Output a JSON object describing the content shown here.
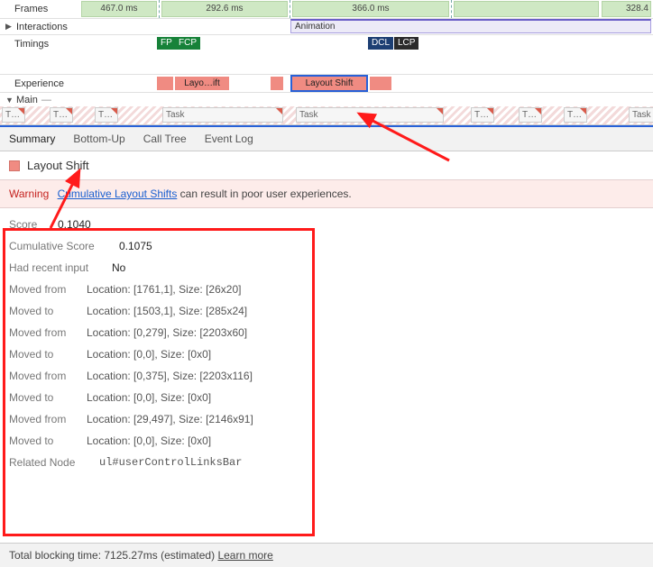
{
  "timeline": {
    "rows": {
      "frames": "Frames",
      "interactions": "Interactions",
      "timings": "Timings",
      "experience": "Experience",
      "main": "Main"
    },
    "frames": [
      "467.0 ms",
      "292.6 ms",
      "366.0 ms",
      "328.4"
    ],
    "animation_label": "Animation",
    "timing_badges": {
      "fp": "FP",
      "fcp": "FCP",
      "dcl": "DCL",
      "lcp": "LCP"
    },
    "experience": {
      "first": "Layo…ift",
      "selected": "Layout Shift"
    },
    "tasks": [
      "T…",
      "T…",
      "T…",
      "Task",
      "Task",
      "T…",
      "T…",
      "T…",
      "Task"
    ]
  },
  "tabs": [
    "Summary",
    "Bottom-Up",
    "Call Tree",
    "Event Log"
  ],
  "section_title": "Layout Shift",
  "warning": {
    "label": "Warning",
    "link": "Cumulative Layout Shifts",
    "rest": " can result in poor user experiences."
  },
  "details": [
    {
      "k": "Score",
      "v": "0.1040"
    },
    {
      "k": "Cumulative Score",
      "v": "0.1075"
    },
    {
      "k": "Had recent input",
      "v": "No"
    },
    {
      "k": "Moved from",
      "v": "Location: [1761,1], Size: [26x20]"
    },
    {
      "k": "Moved to",
      "v": "Location: [1503,1], Size: [285x24]"
    },
    {
      "k": "Moved from",
      "v": "Location: [0,279], Size: [2203x60]"
    },
    {
      "k": "Moved to",
      "v": "Location: [0,0], Size: [0x0]"
    },
    {
      "k": "Moved from",
      "v": "Location: [0,375], Size: [2203x116]"
    },
    {
      "k": "Moved to",
      "v": "Location: [0,0], Size: [0x0]"
    },
    {
      "k": "Moved from",
      "v": "Location: [29,497], Size: [2146x91]"
    },
    {
      "k": "Moved to",
      "v": "Location: [0,0], Size: [0x0]"
    },
    {
      "k": "Related Node",
      "v": "ul#userControlLinksBar",
      "mono": true
    }
  ],
  "footer": {
    "text": "Total blocking time: 7125.27ms (estimated) ",
    "learn": "Learn more"
  }
}
